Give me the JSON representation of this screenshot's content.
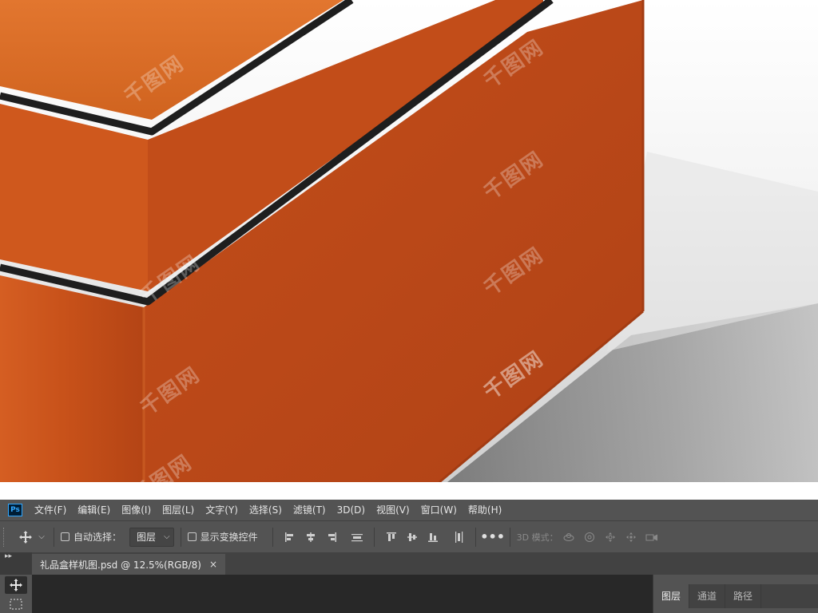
{
  "window": {
    "app_icon": "Ps"
  },
  "menu": [
    "文件(F)",
    "编辑(E)",
    "图像(I)",
    "图层(L)",
    "文字(Y)",
    "选择(S)",
    "滤镜(T)",
    "3D(D)",
    "视图(V)",
    "窗口(W)",
    "帮助(H)"
  ],
  "options": {
    "auto_select_label": "自动选择：",
    "auto_select_value": "图层",
    "show_transform_label": "显示变换控件",
    "mode_3d_label": "3D 模式："
  },
  "document": {
    "tab_title": "礼品盒样机图.psd @ 12.5%(RGB/8)",
    "close_glyph": "×"
  },
  "panels": {
    "tabs": [
      "图层",
      "通道",
      "路径"
    ]
  },
  "watermark": "千图网",
  "colors": {
    "box_orange": "#c9541c",
    "box_shadow": "#a8431a",
    "ps_chrome": "#535353",
    "ps_accent": "#31a8ff"
  }
}
